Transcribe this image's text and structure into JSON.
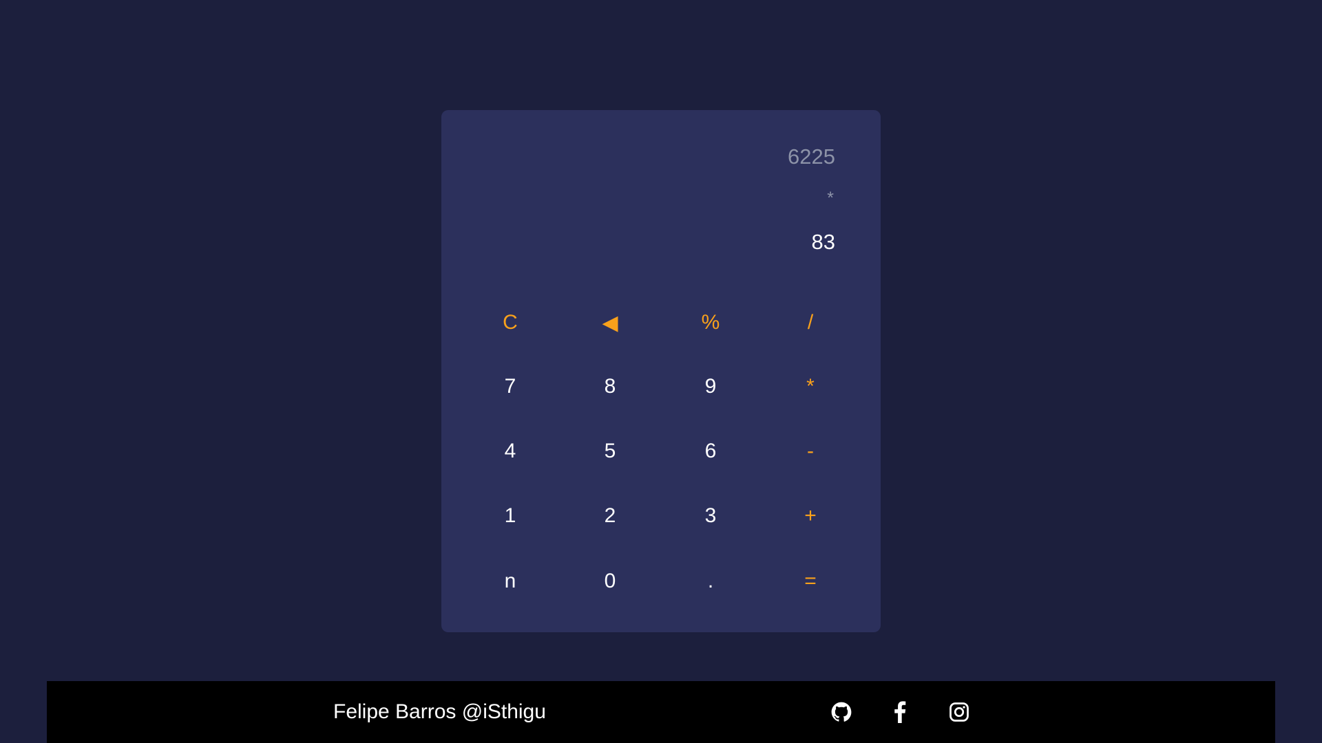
{
  "colors": {
    "background": "#1c1f3d",
    "panel": "#2c305c",
    "accent": "#f9a11b",
    "muted_text": "#8d93a8",
    "text": "#ffffff",
    "footer": "#000000"
  },
  "display": {
    "previous_operand": "6225",
    "operator": "*",
    "current_operand": "83"
  },
  "keys": {
    "clear": "C",
    "backspace": "◀",
    "percent": "%",
    "divide": "/",
    "seven": "7",
    "eight": "8",
    "nine": "9",
    "multiply": "*",
    "four": "4",
    "five": "5",
    "six": "6",
    "subtract": "-",
    "one": "1",
    "two": "2",
    "three": "3",
    "add": "+",
    "negate": "n",
    "zero": "0",
    "decimal": ".",
    "equals": "="
  },
  "footer": {
    "author": "Felipe Barros @iSthigu",
    "icons": [
      "github-icon",
      "facebook-icon",
      "instagram-icon"
    ]
  }
}
